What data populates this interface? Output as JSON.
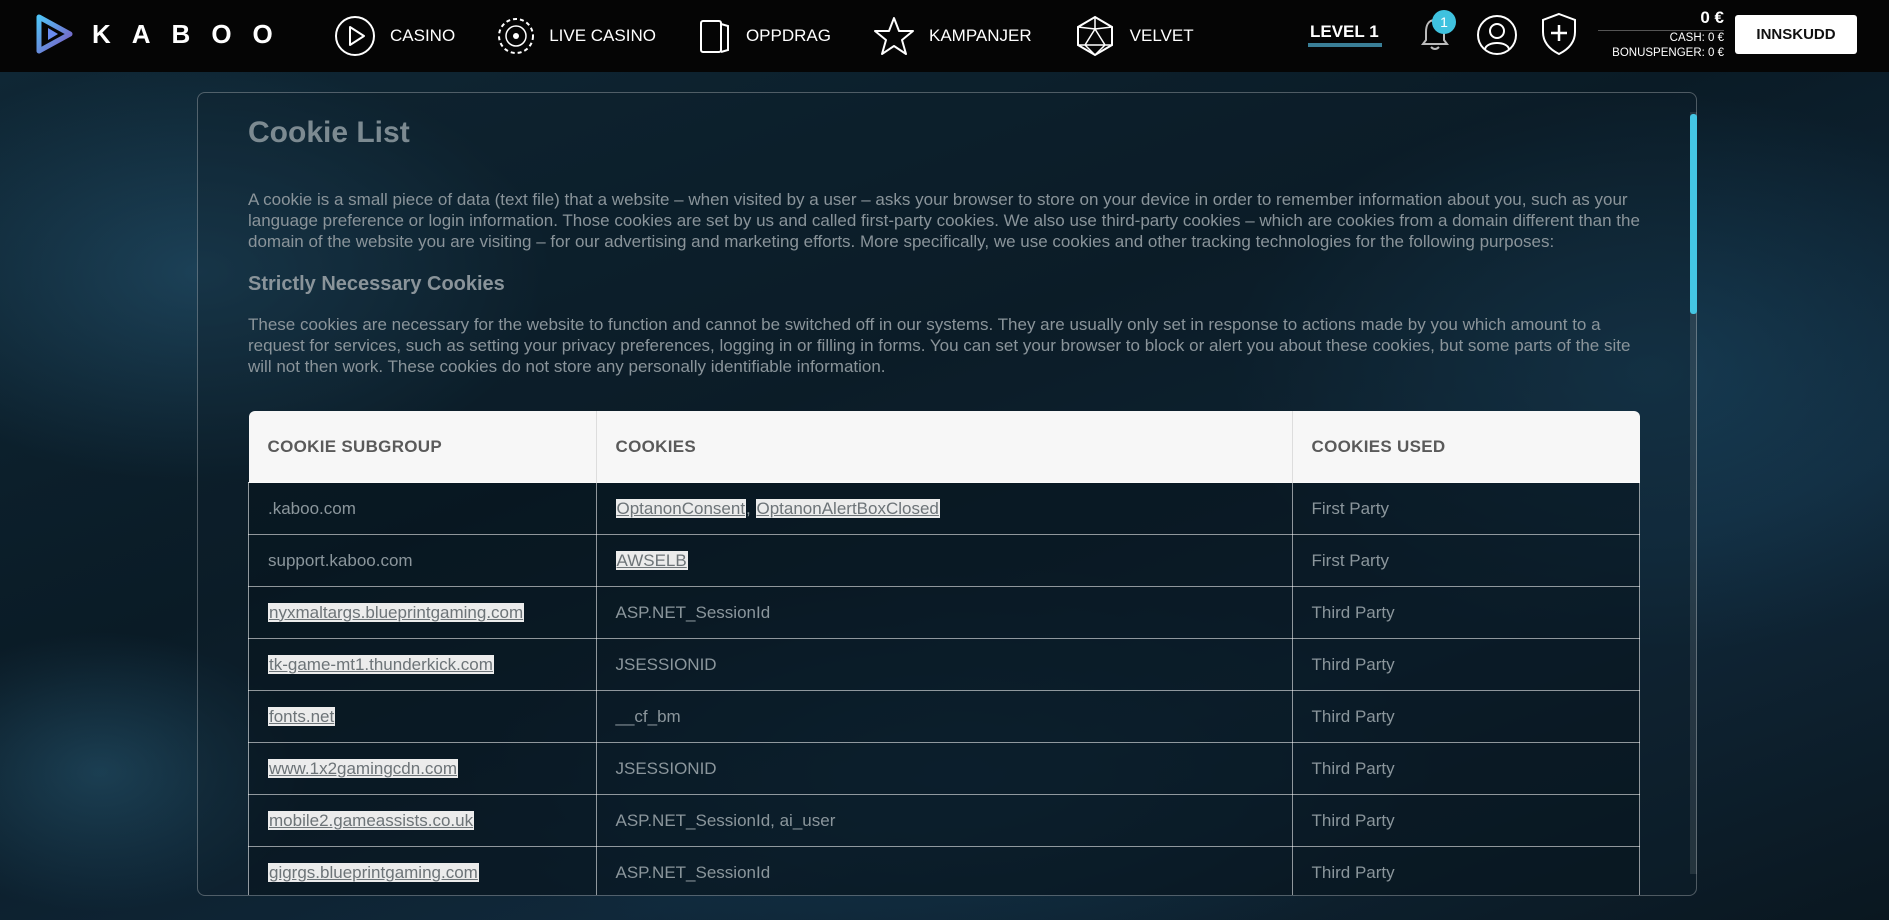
{
  "brand": {
    "name": "KABOO"
  },
  "nav": [
    {
      "label": "CASINO",
      "icon": "play-circle-icon"
    },
    {
      "label": "LIVE CASINO",
      "icon": "chip-icon"
    },
    {
      "label": "OPPDRAG",
      "icon": "cards-icon"
    },
    {
      "label": "KAMPANJER",
      "icon": "star-icon"
    },
    {
      "label": "VELVET",
      "icon": "d20-icon"
    }
  ],
  "account": {
    "level": "LEVEL 1",
    "notifications": "1",
    "balance_total": "0 €",
    "cash": "CASH: 0 €",
    "bonus": "BONUSPENGER: 0 €",
    "deposit_label": "INNSKUDD"
  },
  "page": {
    "title": "Cookie List",
    "intro": "A cookie is a small piece of data (text file) that a website – when visited by a user – asks your browser to store on your device in order to remember information about you, such as your language preference or login information. Those cookies are set by us and called first-party cookies. We also use third-party cookies – which are cookies from a domain different than the domain of the website you are visiting – for our advertising and marketing efforts. More specifically, we use cookies and other tracking technologies for the following purposes:",
    "section_title": "Strictly Necessary Cookies",
    "section_desc": "These cookies are necessary for the website to function and cannot be switched off in our systems. They are usually only set in response to actions made by you which amount to a request for services, such as setting your privacy preferences, logging in or filling in forms. You can set your browser to block or alert you about these cookies, but some parts of the site will not then work. These cookies do not store any personally identifiable information."
  },
  "table": {
    "headers": [
      "COOKIE SUBGROUP",
      "COOKIES",
      "COOKIES USED"
    ],
    "rows": [
      {
        "subgroup": ".kaboo.com",
        "subgroup_link": false,
        "cookies": [
          "OptanonConsent",
          "OptanonAlertBoxClosed"
        ],
        "cookies_link": true,
        "used": "First Party"
      },
      {
        "subgroup": "support.kaboo.com",
        "subgroup_link": false,
        "cookies": [
          "AWSELB"
        ],
        "cookies_link": true,
        "used": "First Party"
      },
      {
        "subgroup": "nyxmaltargs.blueprintgaming.com",
        "subgroup_link": true,
        "cookies": [
          "ASP.NET_SessionId"
        ],
        "cookies_link": false,
        "used": "Third Party"
      },
      {
        "subgroup": "tk-game-mt1.thunderkick.com",
        "subgroup_link": true,
        "cookies": [
          "JSESSIONID"
        ],
        "cookies_link": false,
        "used": "Third Party"
      },
      {
        "subgroup": "fonts.net",
        "subgroup_link": true,
        "cookies": [
          "__cf_bm"
        ],
        "cookies_link": false,
        "used": "Third Party"
      },
      {
        "subgroup": "www.1x2gamingcdn.com",
        "subgroup_link": true,
        "cookies": [
          "JSESSIONID"
        ],
        "cookies_link": false,
        "used": "Third Party"
      },
      {
        "subgroup": "mobile2.gameassists.co.uk",
        "subgroup_link": true,
        "cookies": [
          "ASP.NET_SessionId, ai_user"
        ],
        "cookies_link": false,
        "used": "Third Party"
      },
      {
        "subgroup": "gigrgs.blueprintgaming.com",
        "subgroup_link": true,
        "cookies": [
          "ASP.NET_SessionId"
        ],
        "cookies_link": false,
        "used": "Third Party"
      }
    ]
  }
}
